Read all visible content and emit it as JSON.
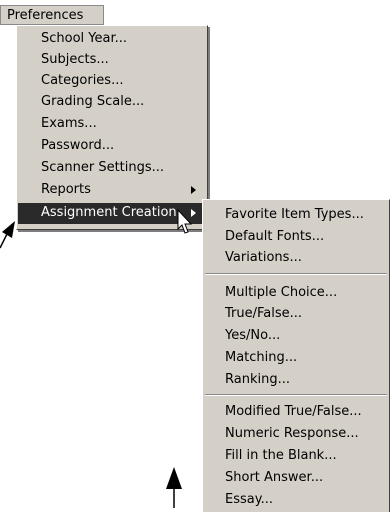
{
  "menubar": {
    "label": "Preferences"
  },
  "main_menu": {
    "items": [
      {
        "label": "School Year..."
      },
      {
        "label": "Subjects..."
      },
      {
        "label": "Categories..."
      },
      {
        "label": "Grading Scale..."
      },
      {
        "label": "Exams..."
      },
      {
        "label": "Password..."
      },
      {
        "label": "Scanner Settings..."
      },
      {
        "label": "Reports"
      },
      {
        "label": "Assignment Creation"
      }
    ]
  },
  "submenu": {
    "groups": [
      [
        {
          "label": "Favorite Item Types..."
        },
        {
          "label": "Default Fonts..."
        },
        {
          "label": "Variations..."
        }
      ],
      [
        {
          "label": "Multiple Choice..."
        },
        {
          "label": "True/False..."
        },
        {
          "label": "Yes/No..."
        },
        {
          "label": "Matching..."
        },
        {
          "label": "Ranking..."
        }
      ],
      [
        {
          "label": "Modified True/False..."
        },
        {
          "label": "Numeric Response..."
        },
        {
          "label": "Fill in the Blank..."
        },
        {
          "label": "Short Answer..."
        },
        {
          "label": "Essay..."
        }
      ]
    ]
  },
  "colors": {
    "menu_bg": "#d4d0c8",
    "highlight_bg": "#2a2a2a",
    "highlight_text": "#ffffff"
  }
}
